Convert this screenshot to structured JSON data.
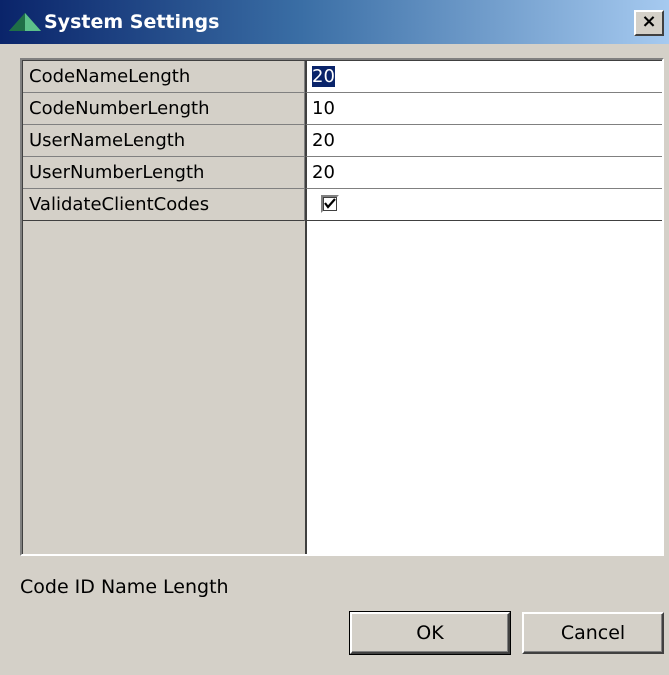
{
  "window": {
    "title": "System Settings",
    "close_glyph": "×",
    "title_icon": "green-pyramid-icon"
  },
  "properties": [
    {
      "name": "CodeNameLength",
      "value": "20",
      "selected": true
    },
    {
      "name": "CodeNumberLength",
      "value": "10"
    },
    {
      "name": "UserNameLength",
      "value": "20"
    },
    {
      "name": "UserNumberLength",
      "value": "20"
    },
    {
      "name": "ValidateClientCodes",
      "value": "checked",
      "type": "checkbox"
    }
  ],
  "description": "Code ID Name Length",
  "buttons": {
    "ok_label": "OK",
    "cancel_label": "Cancel"
  },
  "colors": {
    "title_gradient_start": "#0a246a",
    "title_gradient_end": "#a6caf0",
    "dialog_bg": "#d4d0c8",
    "selection_bg": "#0a246a",
    "icon_green": "#3a9a6a"
  }
}
